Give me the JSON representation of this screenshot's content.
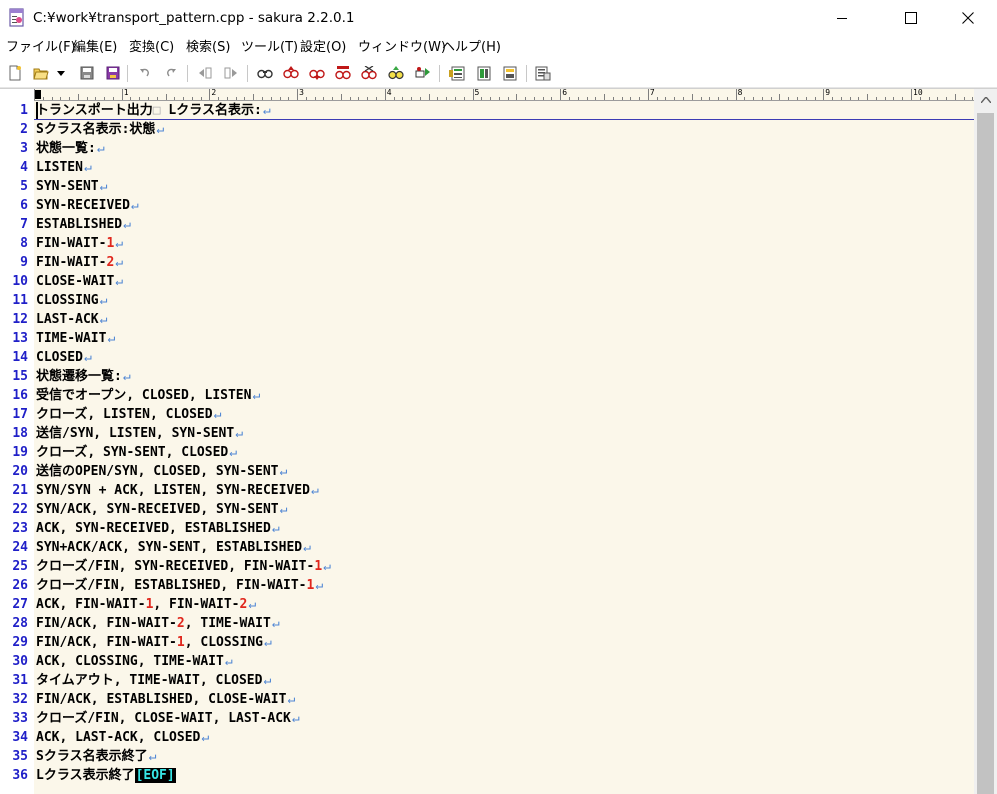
{
  "window": {
    "title": "C:¥work¥transport_pattern.cpp - sakura 2.2.0.1"
  },
  "menu": [
    {
      "id": "file",
      "label": "ファイル(F)"
    },
    {
      "id": "edit",
      "label": "編集(E)"
    },
    {
      "id": "convert",
      "label": "変換(C)"
    },
    {
      "id": "search",
      "label": "検索(S)"
    },
    {
      "id": "tool",
      "label": "ツール(T)"
    },
    {
      "id": "settings",
      "label": "設定(O)"
    },
    {
      "id": "window",
      "label": "ウィンドウ(W)"
    },
    {
      "id": "help",
      "label": "ヘルプ(H)"
    }
  ],
  "toolbar": {
    "buttons": [
      "new-file-icon",
      "open-file-icon",
      "open-dropdown-icon",
      "save-icon",
      "save-all-icon",
      "undo-icon",
      "redo-icon",
      "jump-back-icon",
      "jump-forward-icon",
      "search-icon",
      "search-prev-icon",
      "search-next-icon",
      "search-replace-icon",
      "grep-icon",
      "bookmark-icon",
      "tag-jump-icon",
      "outline-icon",
      "compare-icon",
      "ruler-icon",
      "settings-icon"
    ]
  },
  "ruler": {
    "labels": [
      "1",
      "2",
      "3",
      "4",
      "5",
      "6",
      "7",
      "8",
      "9",
      "10"
    ]
  },
  "editor": {
    "lines": [
      {
        "n": "1",
        "segs": [
          {
            "t": "トランスポート出力"
          },
          {
            "t": "□",
            "c": "sp"
          },
          {
            "t": " Lクラス名表示:"
          }
        ]
      },
      {
        "n": "2",
        "segs": [
          {
            "t": "Sクラス名表示:状態"
          }
        ]
      },
      {
        "n": "3",
        "segs": [
          {
            "t": "状態一覧:"
          }
        ]
      },
      {
        "n": "4",
        "segs": [
          {
            "t": "LISTEN"
          }
        ]
      },
      {
        "n": "5",
        "segs": [
          {
            "t": "SYN-SENT"
          }
        ]
      },
      {
        "n": "6",
        "segs": [
          {
            "t": "SYN-RECEIVED"
          }
        ]
      },
      {
        "n": "7",
        "segs": [
          {
            "t": "ESTABLISHED"
          }
        ]
      },
      {
        "n": "8",
        "segs": [
          {
            "t": "FIN-WAIT-"
          },
          {
            "t": "1",
            "c": "red"
          }
        ]
      },
      {
        "n": "9",
        "segs": [
          {
            "t": "FIN-WAIT-"
          },
          {
            "t": "2",
            "c": "red"
          }
        ]
      },
      {
        "n": "10",
        "segs": [
          {
            "t": "CLOSE-WAIT"
          }
        ]
      },
      {
        "n": "11",
        "segs": [
          {
            "t": "CLOSSING"
          }
        ]
      },
      {
        "n": "12",
        "segs": [
          {
            "t": "LAST-ACK"
          }
        ]
      },
      {
        "n": "13",
        "segs": [
          {
            "t": "TIME-WAIT"
          }
        ]
      },
      {
        "n": "14",
        "segs": [
          {
            "t": "CLOSED"
          }
        ]
      },
      {
        "n": "15",
        "segs": [
          {
            "t": "状態遷移一覧:"
          }
        ]
      },
      {
        "n": "16",
        "segs": [
          {
            "t": "受信でオープン, CLOSED, LISTEN"
          }
        ]
      },
      {
        "n": "17",
        "segs": [
          {
            "t": "クローズ, LISTEN, CLOSED"
          }
        ]
      },
      {
        "n": "18",
        "segs": [
          {
            "t": "送信/SYN, LISTEN, SYN-SENT"
          }
        ]
      },
      {
        "n": "19",
        "segs": [
          {
            "t": "クローズ, SYN-SENT, CLOSED"
          }
        ]
      },
      {
        "n": "20",
        "segs": [
          {
            "t": "送信のOPEN/SYN, CLOSED, SYN-SENT"
          }
        ]
      },
      {
        "n": "21",
        "segs": [
          {
            "t": "SYN/SYN + ACK, LISTEN, SYN-RECEIVED"
          }
        ]
      },
      {
        "n": "22",
        "segs": [
          {
            "t": "SYN/ACK, SYN-RECEIVED, SYN-SENT"
          }
        ]
      },
      {
        "n": "23",
        "segs": [
          {
            "t": "ACK, SYN-RECEIVED, ESTABLISHED"
          }
        ]
      },
      {
        "n": "24",
        "segs": [
          {
            "t": "SYN+ACK/ACK, SYN-SENT, ESTABLISHED"
          }
        ]
      },
      {
        "n": "25",
        "segs": [
          {
            "t": "クローズ/FIN, SYN-RECEIVED, FIN-WAIT-"
          },
          {
            "t": "1",
            "c": "red"
          }
        ]
      },
      {
        "n": "26",
        "segs": [
          {
            "t": "クローズ/FIN, ESTABLISHED, FIN-WAIT-"
          },
          {
            "t": "1",
            "c": "red"
          }
        ]
      },
      {
        "n": "27",
        "segs": [
          {
            "t": "ACK, FIN-WAIT-"
          },
          {
            "t": "1",
            "c": "red"
          },
          {
            "t": ", FIN-WAIT-"
          },
          {
            "t": "2",
            "c": "red"
          }
        ]
      },
      {
        "n": "28",
        "segs": [
          {
            "t": "FIN/ACK, FIN-WAIT-"
          },
          {
            "t": "2",
            "c": "red"
          },
          {
            "t": ", TIME-WAIT"
          }
        ]
      },
      {
        "n": "29",
        "segs": [
          {
            "t": "FIN/ACK, FIN-WAIT-"
          },
          {
            "t": "1",
            "c": "red"
          },
          {
            "t": ", CLOSSING"
          }
        ]
      },
      {
        "n": "30",
        "segs": [
          {
            "t": "ACK, CLOSSING, TIME-WAIT"
          }
        ]
      },
      {
        "n": "31",
        "segs": [
          {
            "t": "タイムアウト, TIME-WAIT, CLOSED"
          }
        ]
      },
      {
        "n": "32",
        "segs": [
          {
            "t": "FIN/ACK, ESTABLISHED, CLOSE-WAIT"
          }
        ]
      },
      {
        "n": "33",
        "segs": [
          {
            "t": "クローズ/FIN, CLOSE-WAIT, LAST-ACK"
          }
        ]
      },
      {
        "n": "34",
        "segs": [
          {
            "t": "ACK, LAST-ACK, CLOSED"
          }
        ]
      },
      {
        "n": "35",
        "segs": [
          {
            "t": "Sクラス名表示終了"
          }
        ]
      },
      {
        "n": "36",
        "segs": [
          {
            "t": "Lクラス表示終了"
          }
        ],
        "eof": "[EOF]"
      }
    ],
    "newline_mark": "↵",
    "colors": {
      "line_number": "#1f1fc8",
      "digit": "#e0271d",
      "newline": "#4f86d4",
      "background": "#fbf7ea",
      "eof_bg": "#000000",
      "eof_fg": "#37e6e6"
    }
  }
}
